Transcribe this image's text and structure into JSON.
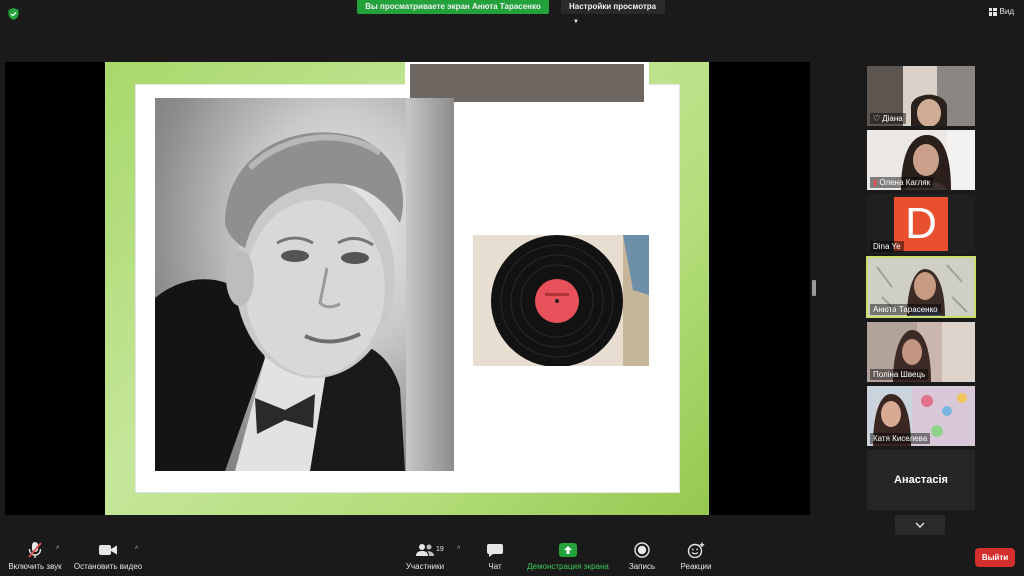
{
  "top": {
    "share_banner": "Вы просматриваете экран Анюта Тарасенко",
    "view_options": "Настройки просмотра",
    "view_button": "Вид"
  },
  "participants": [
    {
      "name": "Діана",
      "icon": "heart-icon"
    },
    {
      "name": "Олена Кагляк",
      "icon": "muted-mic-icon"
    },
    {
      "name": "Dina Ye",
      "avatar_letter": "D",
      "avatar_color": "#e8502f"
    },
    {
      "name": "Анюта Тарасенко",
      "active": true
    },
    {
      "name": "Поліна Швець"
    },
    {
      "name": "Катя Киселева"
    },
    {
      "name": "Анастасія"
    }
  ],
  "toolbar": {
    "unmute": "Включить звук",
    "stop_video": "Остановить видео",
    "participants": "Участники",
    "participants_count": "19",
    "chat": "Чат",
    "share_screen": "Демонстрация экрана",
    "record": "Запись",
    "reactions": "Реакции",
    "leave": "Выйти"
  },
  "colors": {
    "share_green": "#23a13a",
    "leave_red": "#d32f2f",
    "active_speaker": "#c7e06a",
    "slide_green": "#a8d86a"
  }
}
